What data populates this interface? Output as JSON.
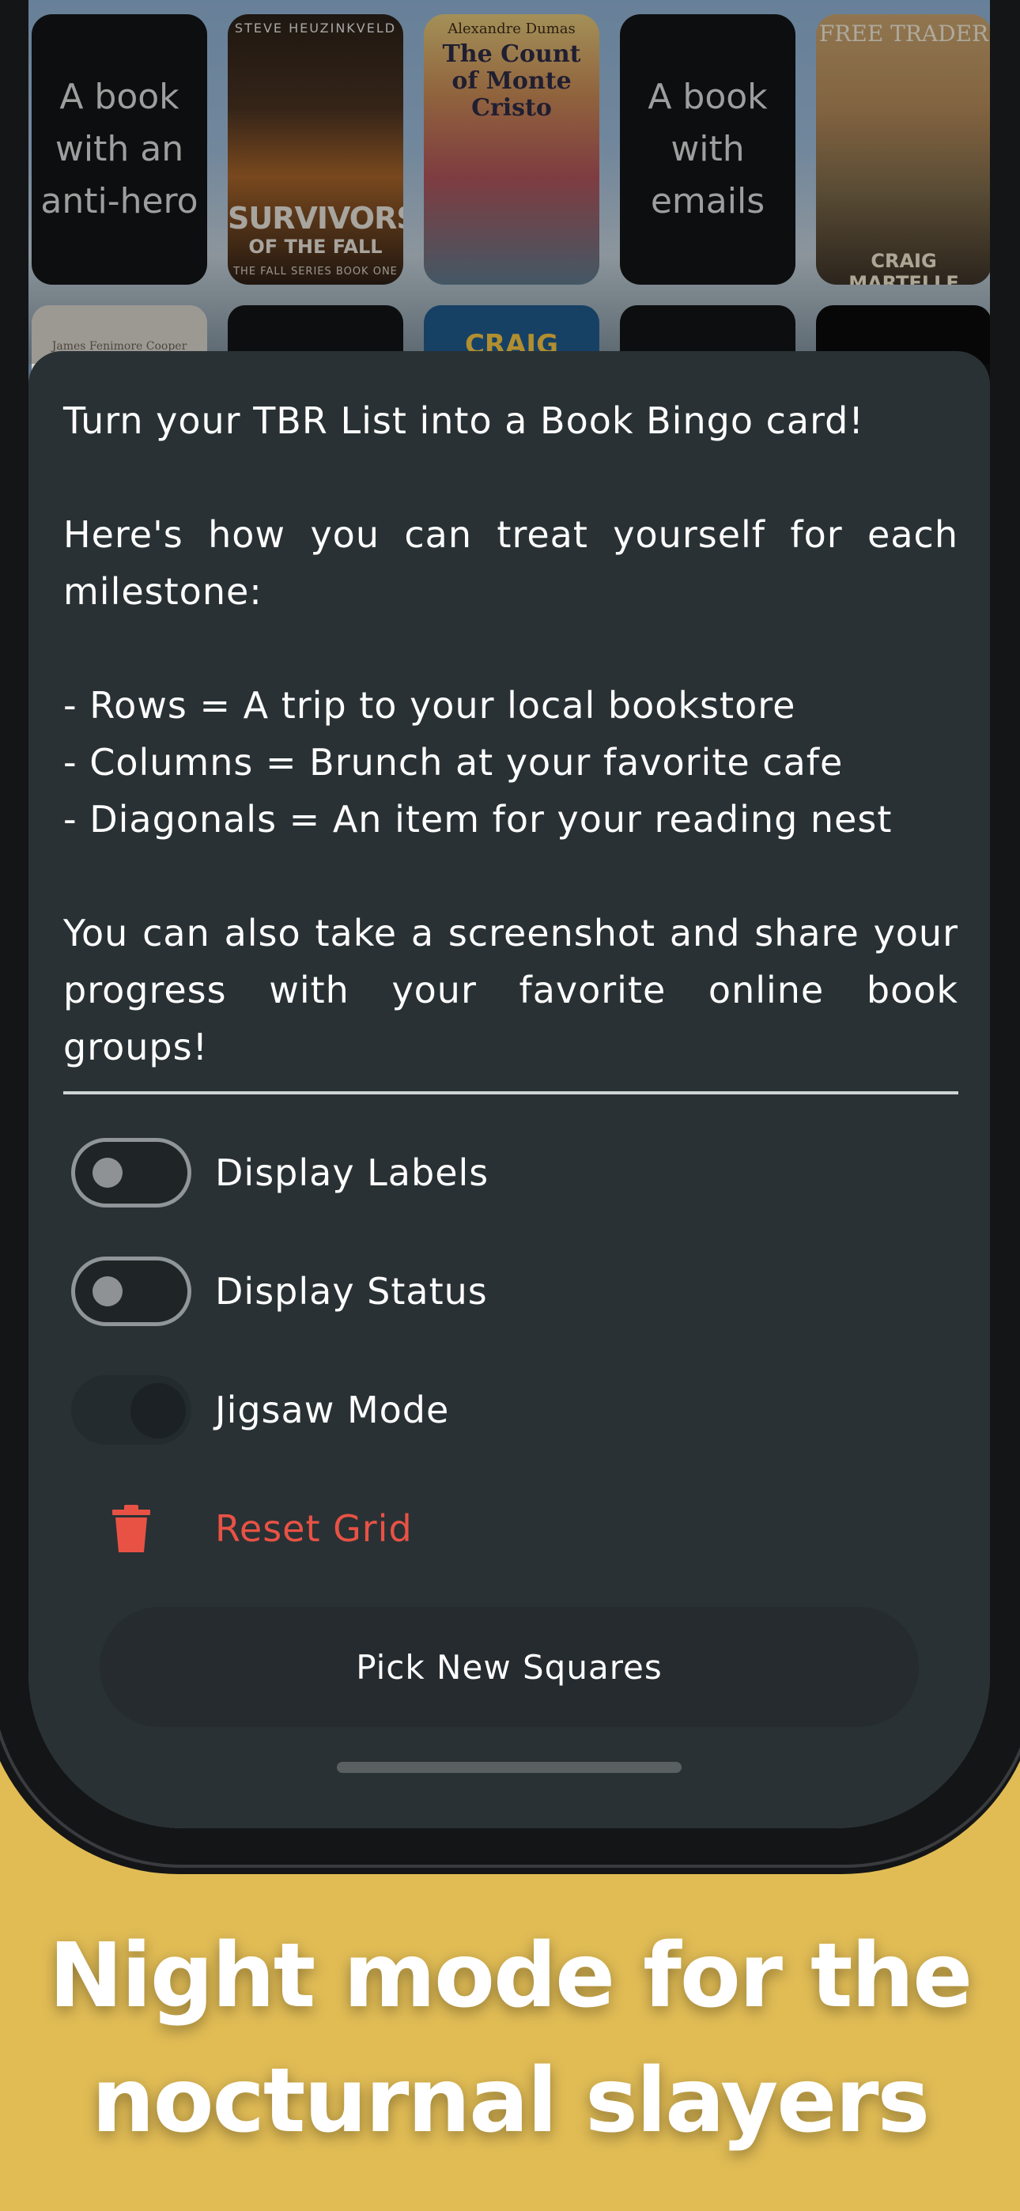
{
  "grid": {
    "row1": [
      {
        "type": "text",
        "label": "A book with an anti-hero"
      },
      {
        "type": "cover",
        "top": "STEVE HEUZINKVELD",
        "title": "SURVIVORS",
        "subtitle": "OF THE FALL",
        "footer": "THE FALL SERIES BOOK ONE"
      },
      {
        "type": "cover",
        "top": "Alexandre Dumas",
        "title": "The Count of Monte Cristo"
      },
      {
        "type": "text",
        "label": "A book with emails"
      },
      {
        "type": "cover",
        "top": "FREE TRADER",
        "title": "",
        "footer": "CRAIG MARTELLE"
      }
    ],
    "row2_partial": [
      "James Fenimore Cooper",
      "",
      "CRAIG",
      "",
      ""
    ]
  },
  "sheet": {
    "intro": "Turn your TBR List into a Book Bingo card!",
    "how_heading": "Here's how you can treat yourself for each milestone:",
    "rewards": [
      "- Rows = A trip to your local bookstore",
      "- Columns = Brunch at your favorite cafe",
      "- Diagonals = An item for your reading nest"
    ],
    "share": "You can also take a screenshot and share your progress with your favorite online book groups!",
    "options": {
      "display_labels": {
        "label": "Display Labels",
        "on": false
      },
      "display_status": {
        "label": "Display Status",
        "on": false
      },
      "jigsaw_mode": {
        "label": "Jigsaw Mode",
        "on": false,
        "disabled": true
      }
    },
    "reset_label": "Reset Grid",
    "pick_label": "Pick New Squares"
  },
  "headline": {
    "line1": "Night mode for the",
    "line2": "nocturnal slayers"
  },
  "colors": {
    "background": "#E1BC55",
    "sheet": "#293134",
    "danger": "#E85245"
  },
  "icons": {
    "reset": "trash-icon"
  }
}
